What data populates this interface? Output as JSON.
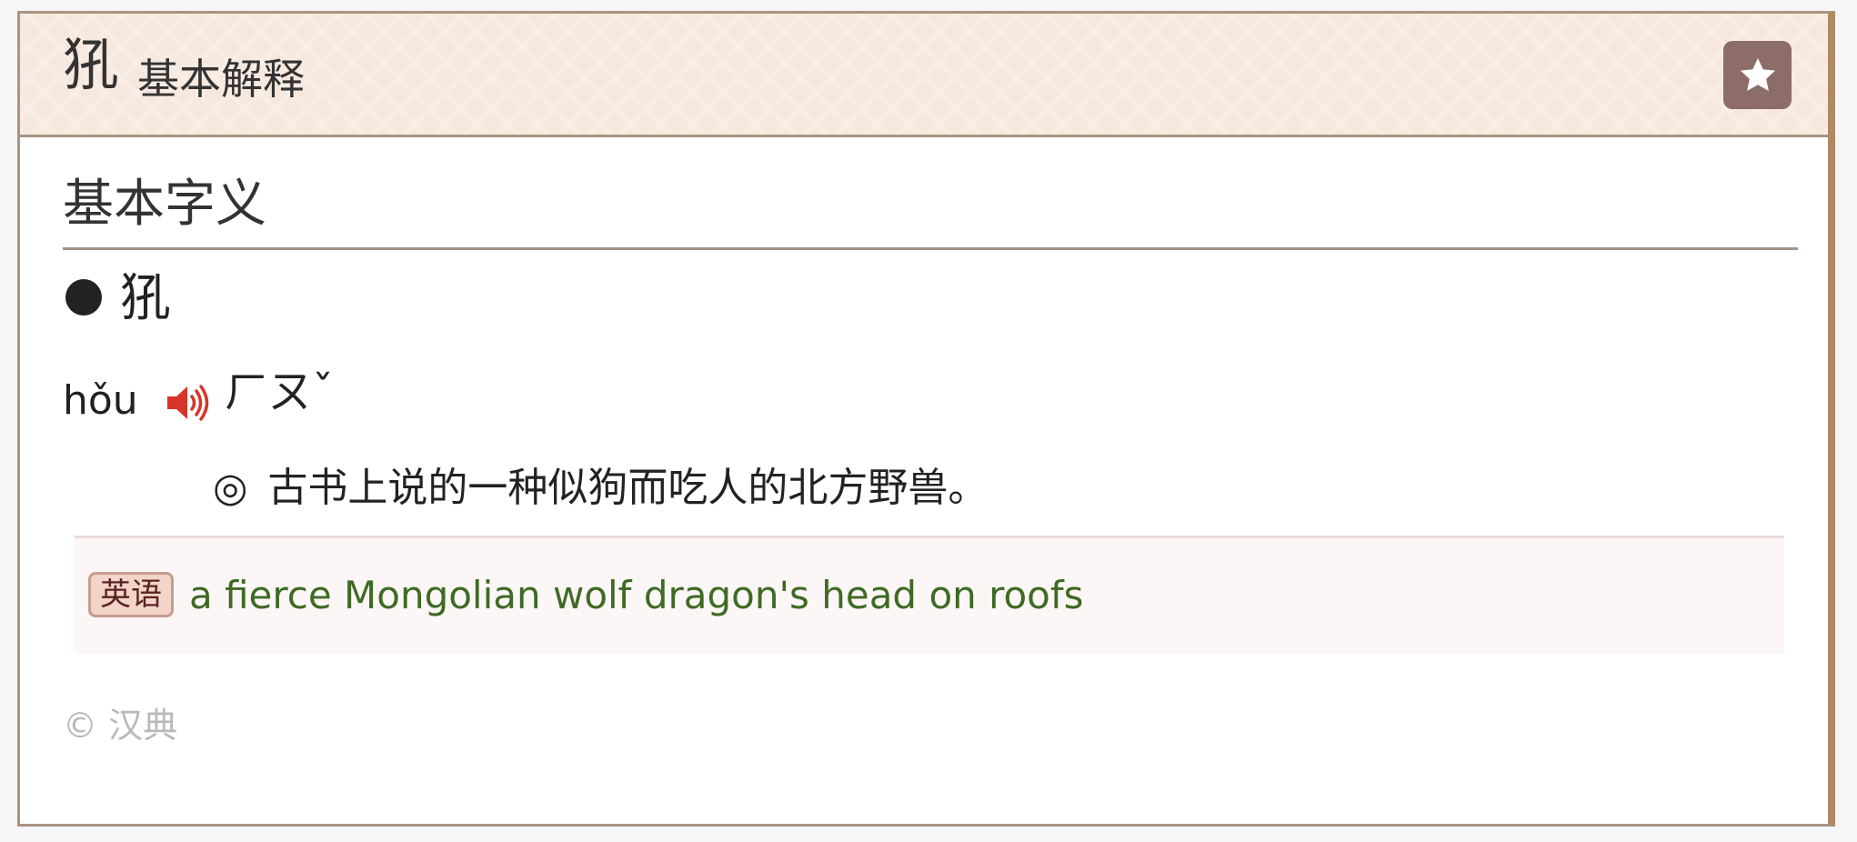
{
  "header": {
    "character": "犼",
    "title": "基本解释",
    "favorite_icon": "star-icon"
  },
  "section": {
    "title": "基本字义"
  },
  "entry": {
    "character": "犼",
    "bullet_icon": "bullet-icon",
    "pinyin": "hǒu",
    "audio_icon": "speaker-icon",
    "zhuyin": "ㄏㄡˇ",
    "definition_marker": "◎",
    "definition": "古书上说的一种似狗而吃人的北方野兽。"
  },
  "english": {
    "tag": "英语",
    "text": "a fierce Mongolian wolf dragon's head on roofs"
  },
  "footer": {
    "copyright": "© 汉典"
  },
  "colors": {
    "header_bg": "#f6e8dd",
    "border": "#a89480",
    "star_button": "#8d6d67",
    "audio_icon": "#d7352a",
    "english_text": "#3f6a24",
    "english_tag_bg": "#f2d4c8",
    "copyright_text": "#b9b9b9"
  }
}
